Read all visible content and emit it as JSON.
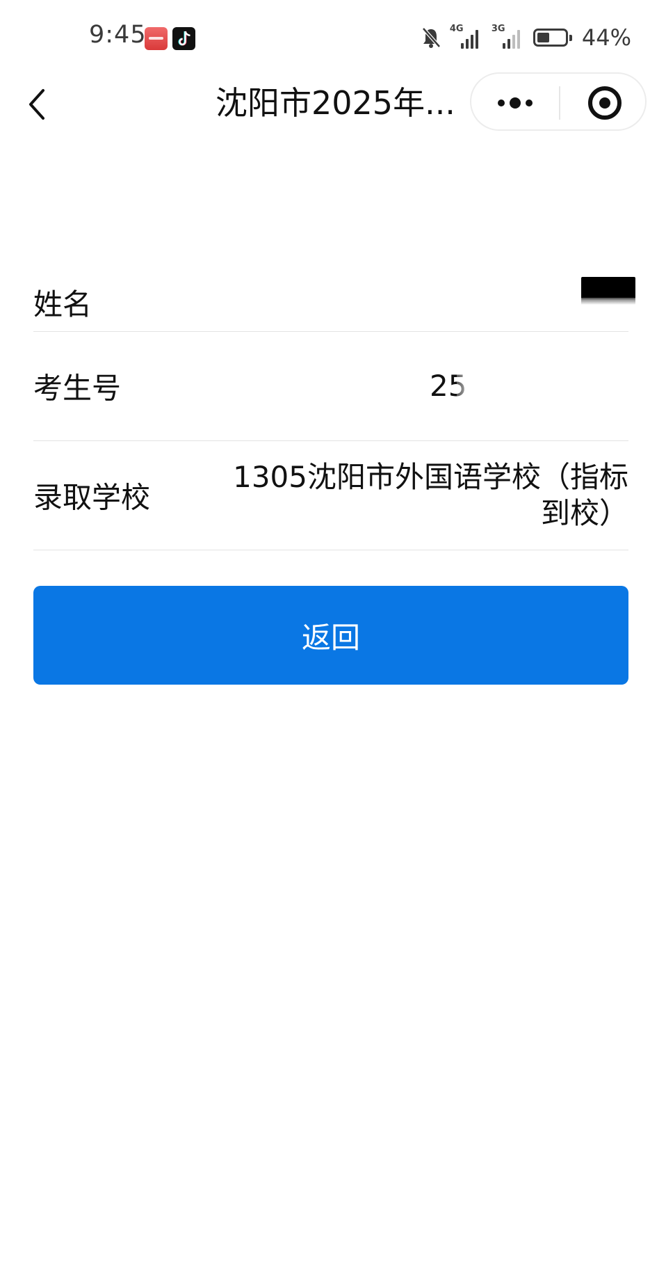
{
  "status_bar": {
    "time": "9:45",
    "network_1": "4G",
    "network_2": "3G",
    "battery_percent": "44%",
    "battery_level": 0.44,
    "icons": [
      "huawei-appgallery-icon",
      "tiktok-icon",
      "mute-bell-icon",
      "signal-icon",
      "battery-icon"
    ]
  },
  "nav": {
    "title": "沈阳市2025年...",
    "icons": [
      "chevron-left-icon",
      "more-dots-icon",
      "target-close-icon"
    ]
  },
  "form": {
    "rows": [
      {
        "label": "姓名",
        "value": ""
      },
      {
        "label": "考生号",
        "value": "25"
      },
      {
        "label": "录取学校",
        "value": "1305沈阳市外国语学校（指标到校）"
      }
    ]
  },
  "actions": {
    "back_label": "返回",
    "accent_color": "#0a77e4"
  }
}
